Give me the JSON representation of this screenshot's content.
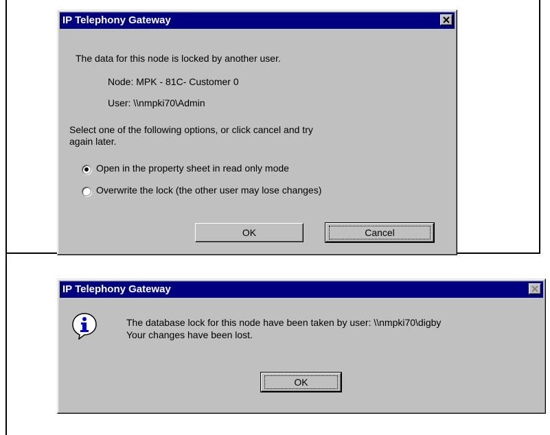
{
  "dialog_lock": {
    "title": "IP Telephony Gateway",
    "message": "The data for this node is locked by another user.",
    "node_line": "Node: MPK - 81C- Customer 0",
    "user_line": "User:  \\\\nmpki70\\Admin",
    "instructions_line1": "Select one of the following options, or click cancel and try",
    "instructions_line2": "again later.",
    "options": [
      {
        "label": "Open in the property sheet in read only mode",
        "selected": true
      },
      {
        "label": "Overwrite the lock (the other user may lose changes)",
        "selected": false
      }
    ],
    "ok_label": "OK",
    "cancel_label": "Cancel"
  },
  "dialog_info": {
    "title": "IP Telephony Gateway",
    "message_line1": "The database lock for this node have been taken by user: \\\\nmpki70\\digby",
    "message_line2": "Your changes have been lost.",
    "ok_label": "OK",
    "icon": "info-icon"
  },
  "colors": {
    "titlebar": "#000080",
    "dialog_face": "#c0c0c0"
  }
}
